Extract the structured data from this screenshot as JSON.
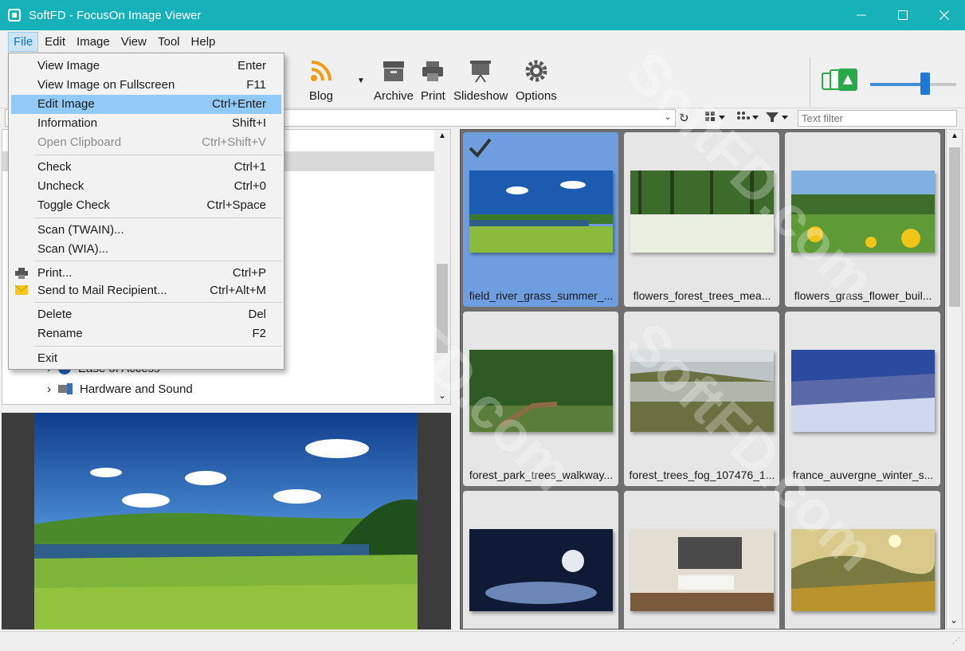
{
  "window": {
    "title": "SoftFD - FocusOn Image Viewer"
  },
  "menubar": [
    "File",
    "Edit",
    "Image",
    "View",
    "Tool",
    "Help"
  ],
  "toolbar": {
    "blog": "Blog",
    "archive": "Archive",
    "print": "Print",
    "slideshow": "Slideshow",
    "options": "Options",
    "zoom_level": 0.65
  },
  "filter": {
    "placeholder": "Text filter"
  },
  "tree": {
    "items": [
      "Ease of Access",
      "Hardware and Sound"
    ]
  },
  "file_menu": [
    {
      "label": "View Image",
      "shortcut": "Enter"
    },
    {
      "label": "View Image on Fullscreen",
      "shortcut": "F11"
    },
    {
      "label": "Edit Image",
      "shortcut": "Ctrl+Enter"
    },
    {
      "label": "Information",
      "shortcut": "Shift+I"
    },
    {
      "label": "Open Clipboard",
      "shortcut": "Ctrl+Shift+V"
    },
    {
      "label": "Check",
      "shortcut": "Ctrl+1"
    },
    {
      "label": "Uncheck",
      "shortcut": "Ctrl+0"
    },
    {
      "label": "Toggle Check",
      "shortcut": "Ctrl+Space"
    },
    {
      "label": "Scan (TWAIN)...",
      "shortcut": ""
    },
    {
      "label": "Scan (WIA)...",
      "shortcut": ""
    },
    {
      "label": "Print...",
      "shortcut": "Ctrl+P"
    },
    {
      "label": "Send to Mail Recipient...",
      "shortcut": "Ctrl+Alt+M"
    },
    {
      "label": "Delete",
      "shortcut": "Del"
    },
    {
      "label": "Rename",
      "shortcut": "F2"
    },
    {
      "label": "Exit",
      "shortcut": ""
    }
  ],
  "thumbnails": [
    "field_river_grass_summer_...",
    "flowers_forest_trees_mea...",
    "flowers_grass_flower_buil...",
    "forest_park_trees_walkway...",
    "forest_trees_fog_107476_1...",
    "france_auvergne_winter_s..."
  ],
  "watermark": "SoftFD.com",
  "colors": {
    "titlebar": "#16b1b9",
    "menu_highlight": "#91c9f7",
    "selected_thumb": "#6e9ee0"
  }
}
